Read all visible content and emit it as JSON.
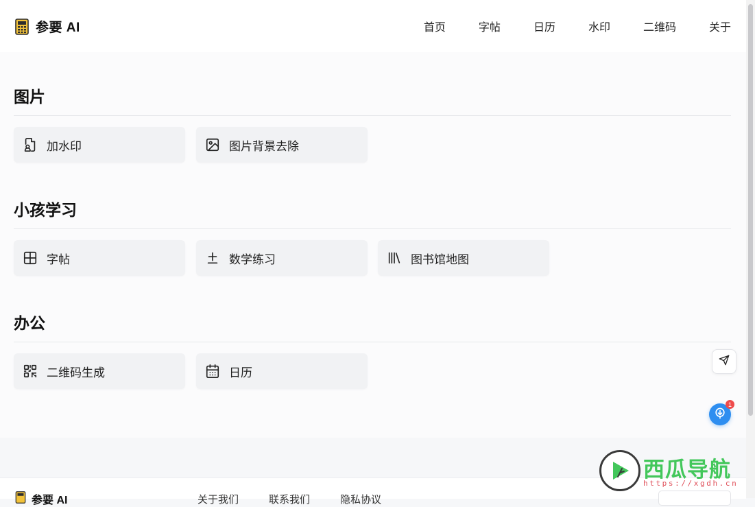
{
  "header": {
    "brand": "参要 AI",
    "nav": [
      "首页",
      "字帖",
      "日历",
      "水印",
      "二维码",
      "关于"
    ]
  },
  "sections": [
    {
      "title": "图片",
      "items": [
        {
          "label": "加水印",
          "icon": "watermark-file-icon"
        },
        {
          "label": "图片背景去除",
          "icon": "image-icon"
        }
      ]
    },
    {
      "title": "小孩学习",
      "items": [
        {
          "label": "字帖",
          "icon": "grid-icon"
        },
        {
          "label": "数学练习",
          "icon": "plus-minus-icon"
        },
        {
          "label": "图书馆地图",
          "icon": "library-icon"
        }
      ]
    },
    {
      "title": "办公",
      "items": [
        {
          "label": "二维码生成",
          "icon": "qrcode-icon"
        },
        {
          "label": "日历",
          "icon": "calendar-icon"
        }
      ]
    }
  ],
  "floating": {
    "badge_count": "1"
  },
  "footer": {
    "brand": "参要 AI",
    "links": [
      "关于我们",
      "联系我们",
      "隐私协议"
    ]
  },
  "watermark": {
    "name": "西瓜导航",
    "url": "https://xgdh.cn"
  },
  "colors": {
    "accent_blue": "#2e8ef0",
    "badge_red": "#ef4b4b",
    "watermark_green": "#43c75b"
  }
}
